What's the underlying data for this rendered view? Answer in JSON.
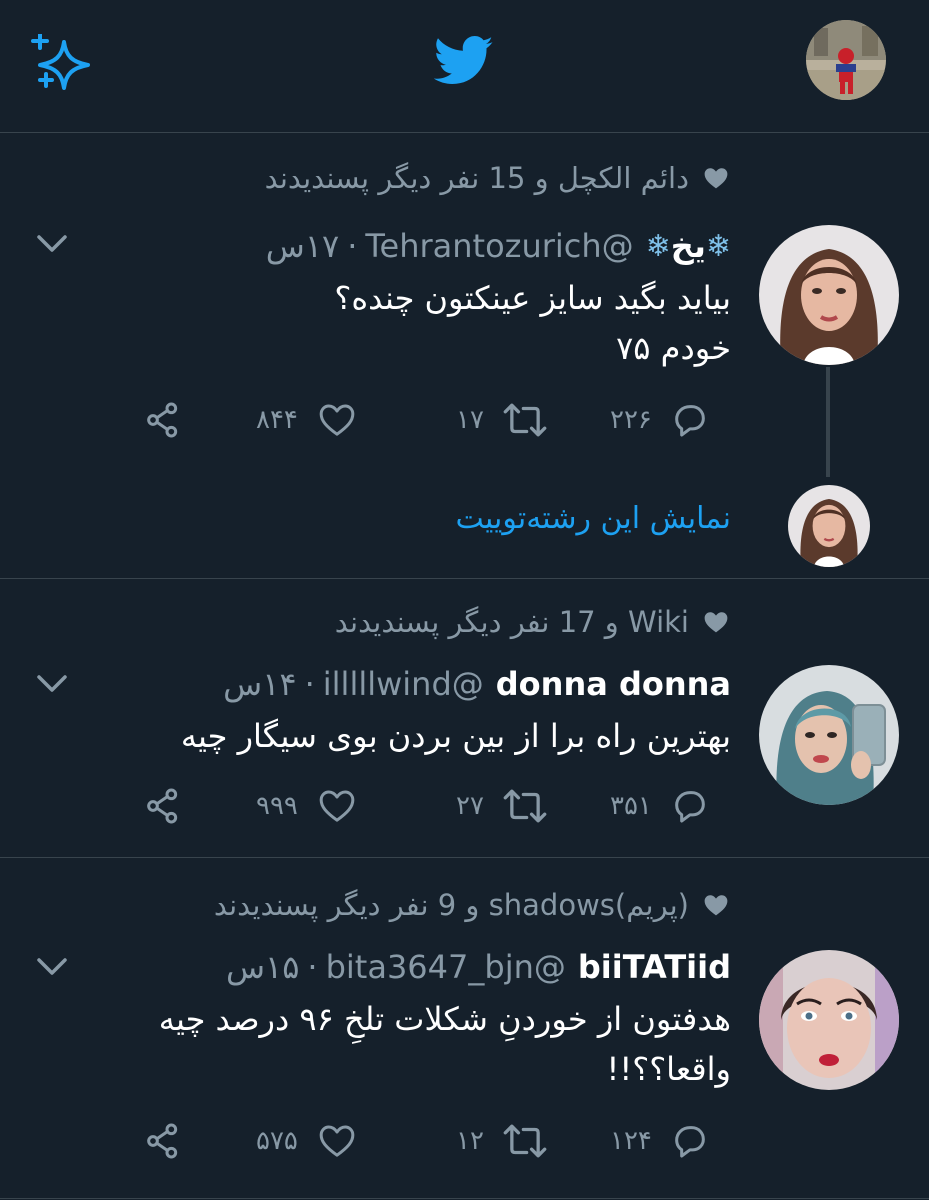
{
  "header": {
    "sparkle_icon": "sparkle-icon",
    "logo_icon": "twitter-bird-icon",
    "accent": "#1da1f2"
  },
  "tweets": [
    {
      "liked_by": "دائم الکچل و 15 نفر دیگر پسندیدند",
      "display_name": "یخ",
      "name_emoji": "❄",
      "handle": "@Tehrantozurich",
      "time": "۱۷س",
      "text_lines": [
        "بیاید بگید سایز عینکتون چنده؟",
        "خودم ۷۵"
      ],
      "replies": "۲۲۶",
      "retweets": "۱۷",
      "likes": "۸۴۴",
      "show_thread": "نمایش این رشته‌توییت"
    },
    {
      "liked_by": "Wiki و 17 نفر دیگر پسندیدند",
      "display_name": "donna donna",
      "handle": "@illlllwind",
      "time": "۱۴س",
      "text_lines": [
        "بهترین راه برا از بین بردن بوی سیگار چیه"
      ],
      "replies": "۳۵۱",
      "retweets": "۲۷",
      "likes": "۹۹۹"
    },
    {
      "liked_by": "(پریم)shadows و 9 نفر دیگر پسندیدند",
      "display_name": "biiTATiid",
      "handle": "@bita3647_bjn",
      "time": "۱۵س",
      "text_lines": [
        "هدفتون از خوردنِ شکلات تلخِ ۹۶ درصد چیه",
        "واقعا؟؟!!"
      ],
      "replies": "۱۲۴",
      "retweets": "۱۲",
      "likes": "۵۷۵"
    }
  ]
}
